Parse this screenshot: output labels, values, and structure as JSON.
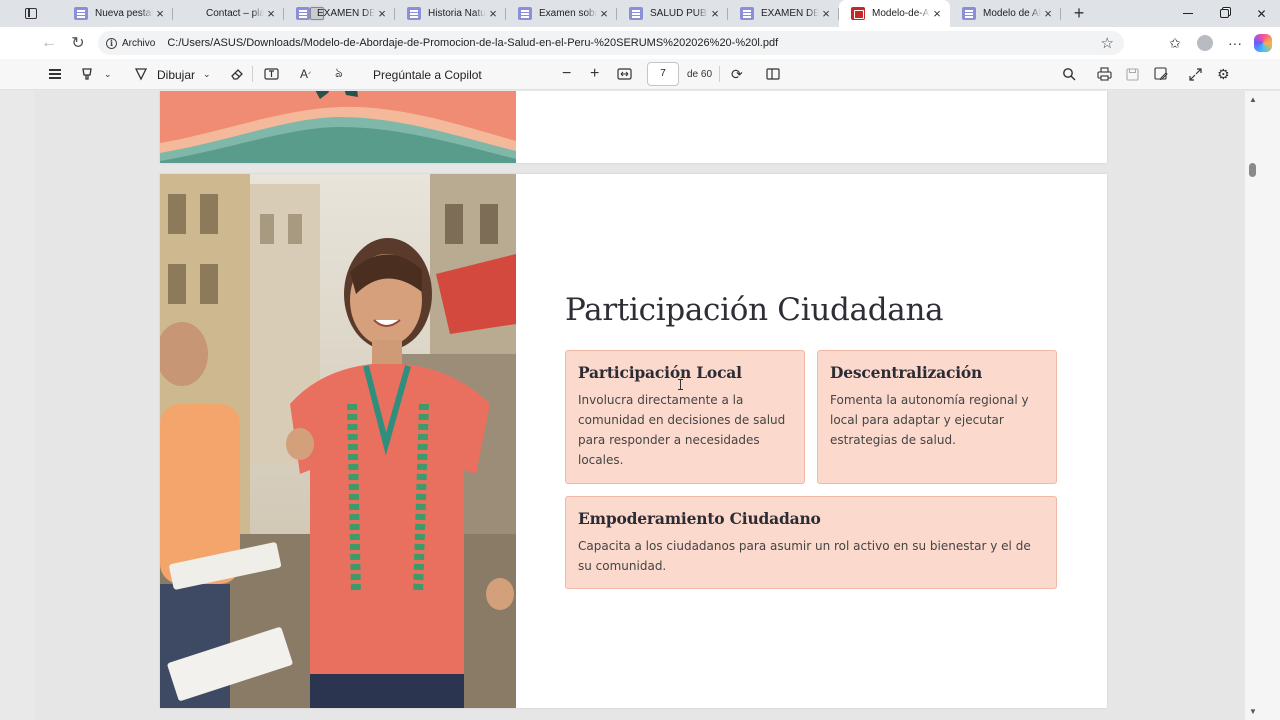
{
  "tabs": [
    {
      "label": "Nueva pestaña",
      "icon": "doc-icon",
      "active": false
    },
    {
      "label": "Contact – plan",
      "icon": "page-icon",
      "active": false
    },
    {
      "label": "EXAMEN DE SA",
      "icon": "doc-icon",
      "active": false
    },
    {
      "label": "Historia Natural",
      "icon": "doc-icon",
      "active": false
    },
    {
      "label": "Examen sobre l",
      "icon": "doc-icon",
      "active": false
    },
    {
      "label": "SALUD PUBLIC",
      "icon": "doc-icon",
      "active": false
    },
    {
      "label": "EXAMEN DE SA",
      "icon": "doc-icon",
      "active": false
    },
    {
      "label": "Modelo-de-Ab",
      "icon": "pdf-icon",
      "active": true
    },
    {
      "label": "Modelo de Abc",
      "icon": "doc-icon",
      "active": false
    }
  ],
  "address": {
    "chip": "Archivo",
    "url": "C:/Users/ASUS/Downloads/Modelo-de-Abordaje-de-Promocion-de-la-Salud-en-el-Peru-%20SERUMS%202026%20-%20l.pdf"
  },
  "pdf_toolbar": {
    "draw_label": "Dibujar",
    "copilot_label": "Pregúntale a Copilot",
    "page_current": "7",
    "page_total_label": "de 60"
  },
  "slide": {
    "title": "Participación Ciudadana",
    "cards": [
      {
        "title": "Participación Local",
        "text": "Involucra directamente a la comunidad en decisiones de salud para responder a necesidades locales."
      },
      {
        "title": "Descentralización",
        "text": "Fomenta la autonomía regional y local para adaptar y ejecutar estrategias de salud."
      },
      {
        "title": "Empoderamiento Ciudadano",
        "text": "Capacita a los ciudadanos para asumir un rol activo en su bienestar y el de su comunidad."
      }
    ]
  },
  "colors": {
    "card_bg": "#fcd9cd",
    "card_border": "#f0b8a6",
    "title_text": "#2e2e36",
    "pdf_favicon": "#c62828"
  }
}
